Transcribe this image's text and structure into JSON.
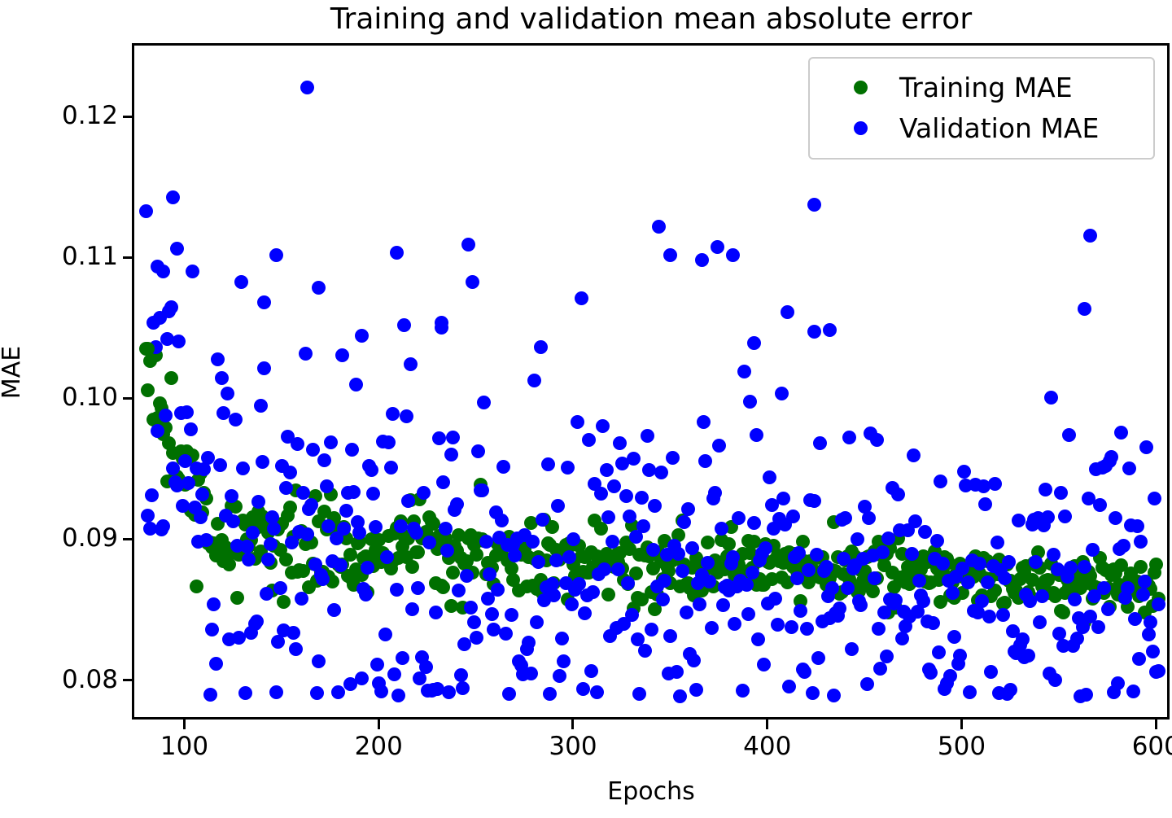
{
  "chart_data": {
    "type": "scatter",
    "title": "Training and validation mean absolute error",
    "xlabel": "Epochs",
    "ylabel": "MAE",
    "xlim": [
      73,
      607
    ],
    "ylim": [
      0.0772,
      0.1252
    ],
    "xticks": [
      100,
      200,
      300,
      400,
      500,
      600
    ],
    "xticklabels": [
      "100",
      "200",
      "300",
      "400",
      "500",
      "600"
    ],
    "yticks": [
      0.08,
      0.09,
      0.1,
      0.11,
      0.12
    ],
    "yticklabels": [
      "0.08",
      "0.09",
      "0.10",
      "0.11",
      "0.12"
    ],
    "grid": false,
    "legend_position": "upper right",
    "marker": "circle",
    "marker_size_px": 17,
    "series": [
      {
        "name": "Training MAE",
        "color": "#007000",
        "x_start": 79,
        "x_end": 600,
        "n_points": 522,
        "trend_start": 0.1035,
        "trend_knee_epoch": 120,
        "trend_knee_value": 0.09,
        "trend_end": 0.0868,
        "noise_start": 0.0022,
        "noise_end": 0.0011,
        "y_min": 0.0825,
        "y_max": 0.104
      },
      {
        "name": "Validation MAE",
        "color": "#0000ff",
        "x_start": 79,
        "x_end": 600,
        "n_points": 522,
        "trend_start": 0.102,
        "trend_knee_epoch": 120,
        "trend_knee_value": 0.089,
        "trend_end": 0.0872,
        "noise_start": 0.0075,
        "noise_end": 0.005,
        "y_min": 0.079,
        "y_max": 0.1222,
        "outlier_rate": 0.07
      }
    ],
    "notable_points": [
      {
        "series": "Validation MAE",
        "x": 162,
        "y": 0.1222,
        "note": "highest outlier"
      },
      {
        "series": "Validation MAE",
        "x": 93,
        "y": 0.1144
      },
      {
        "series": "Validation MAE",
        "x": 423,
        "y": 0.1139
      },
      {
        "series": "Validation MAE",
        "x": 565,
        "y": 0.1117
      },
      {
        "series": "Validation MAE",
        "x": 95,
        "y": 0.1108
      },
      {
        "series": "Validation MAE",
        "x": 208,
        "y": 0.1105
      },
      {
        "series": "Validation MAE",
        "x": 146,
        "y": 0.1103
      },
      {
        "series": "Validation MAE",
        "x": 349,
        "y": 0.1103
      },
      {
        "series": "Validation MAE",
        "x": 381,
        "y": 0.1103
      },
      {
        "series": "Validation MAE",
        "x": 365,
        "y": 0.11
      },
      {
        "series": "Validation MAE",
        "x": 85,
        "y": 0.1095
      },
      {
        "series": "Validation MAE",
        "x": 88,
        "y": 0.1092
      },
      {
        "series": "Validation MAE",
        "x": 168,
        "y": 0.108
      },
      {
        "series": "Validation MAE",
        "x": 140,
        "y": 0.107
      },
      {
        "series": "Validation MAE",
        "x": 562,
        "y": 0.1065
      },
      {
        "series": "Validation MAE",
        "x": 231,
        "y": 0.1052
      },
      {
        "series": "Validation MAE",
        "x": 431,
        "y": 0.105
      },
      {
        "series": "Validation MAE",
        "x": 423,
        "y": 0.1049
      },
      {
        "series": "Validation MAE",
        "x": 190,
        "y": 0.1046
      },
      {
        "series": "Validation MAE",
        "x": 392,
        "y": 0.1041
      },
      {
        "series": "Training MAE",
        "x": 80,
        "y": 0.1037
      },
      {
        "series": "Validation MAE",
        "x": 600,
        "y": 0.0808
      }
    ]
  },
  "legend": {
    "items": [
      {
        "label": "Training MAE",
        "color": "#007000"
      },
      {
        "label": "Validation MAE",
        "color": "#0000ff"
      }
    ]
  },
  "axes": {
    "title": "Training and validation mean absolute error",
    "xlabel": "Epochs",
    "ylabel": "MAE"
  }
}
